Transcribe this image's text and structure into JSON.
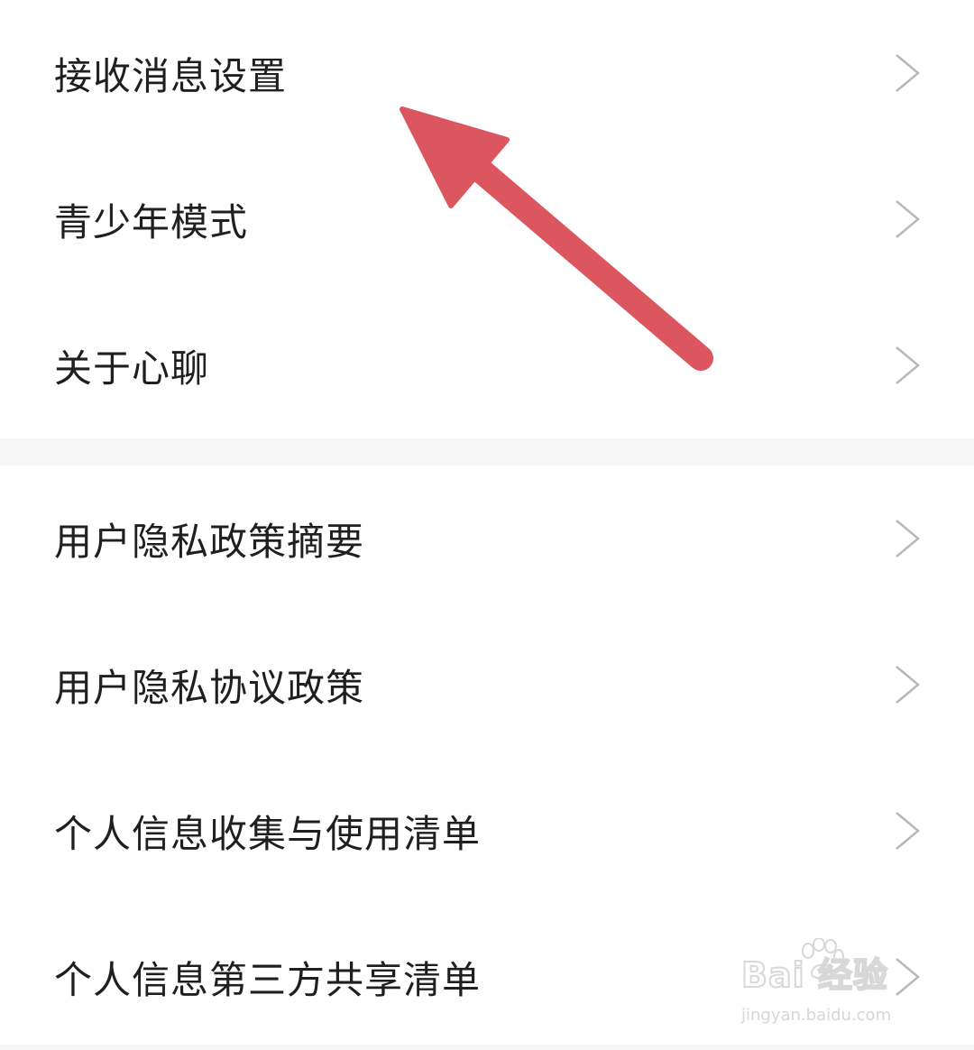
{
  "settings": {
    "group1": [
      {
        "label": "接收消息设置"
      },
      {
        "label": "青少年模式"
      },
      {
        "label": "关于心聊"
      }
    ],
    "group2": [
      {
        "label": "用户隐私政策摘要"
      },
      {
        "label": "用户隐私协议政策"
      },
      {
        "label": "个人信息收集与使用清单"
      },
      {
        "label": "个人信息第三方共享清单"
      }
    ]
  },
  "annotation": {
    "arrow_color": "#dc5660",
    "points_to": "接收消息设置"
  },
  "watermark": {
    "brand": "Bai  经验",
    "url": "jingyan.baidu.com"
  },
  "icons": {
    "chevron": "chevron-right-icon",
    "arrow": "red-arrow-annotation",
    "paw": "baidu-paw-icon"
  }
}
